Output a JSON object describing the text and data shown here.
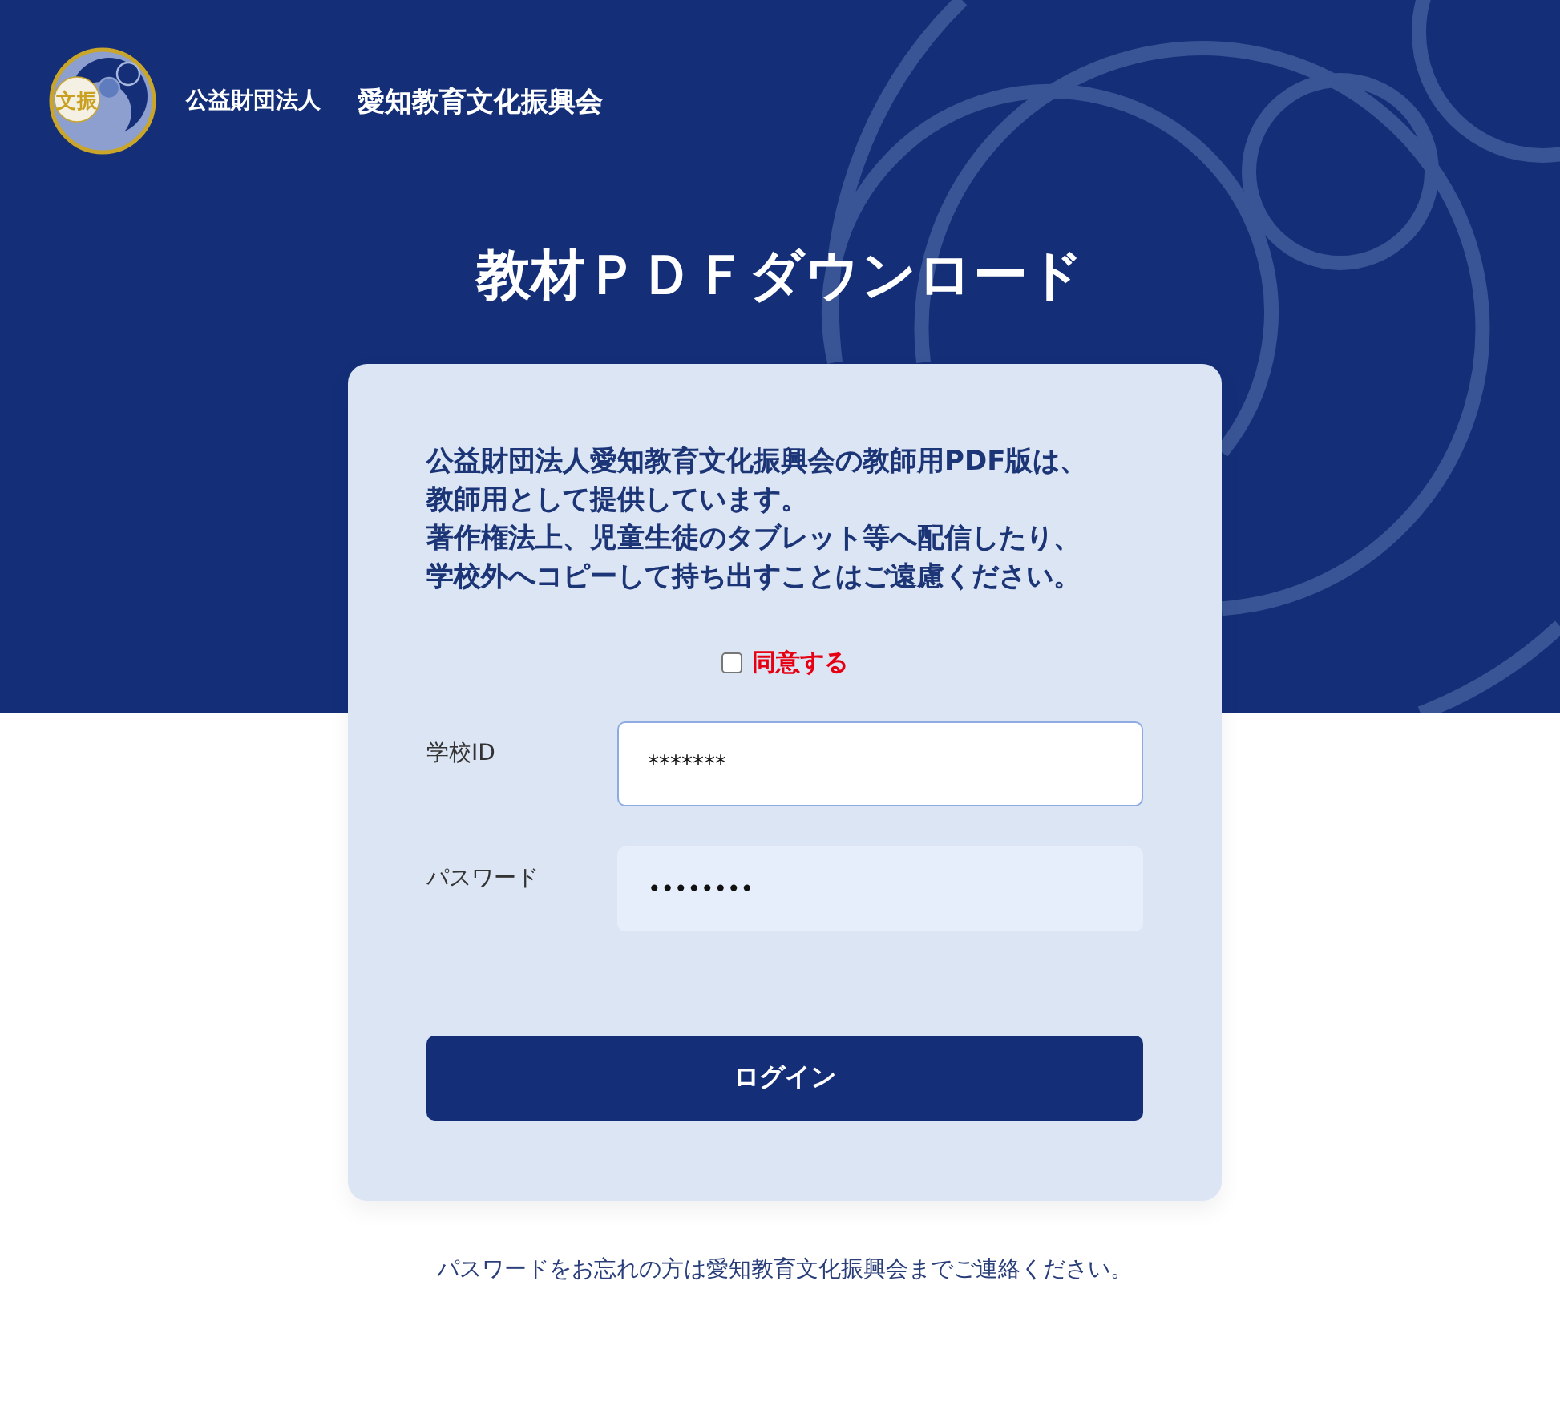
{
  "header": {
    "logo_text": "文振",
    "org_type": "公益財団法人",
    "org_name": "愛知教育文化振興会"
  },
  "title": "教材ＰＤＦダウンロード",
  "notice": {
    "lines": [
      "公益財団法人愛知教育文化振興会の教師用PDF版は、",
      "教師用として提供しています。",
      "著作権法上、児童生徒のタブレット等へ配信したり、",
      "学校外へコピーして持ち出すことはご遠慮ください。"
    ]
  },
  "agree": {
    "label": "同意する",
    "checked": false
  },
  "fields": [
    {
      "label": "学校ID",
      "value": "*******",
      "focused": true
    },
    {
      "label": "パスワード",
      "value": "••••••••",
      "focused": false
    }
  ],
  "login_button": "ログイン",
  "footer_note": "パスワードをお忘れの方は愛知教育文化振興会までご連絡ください。"
}
